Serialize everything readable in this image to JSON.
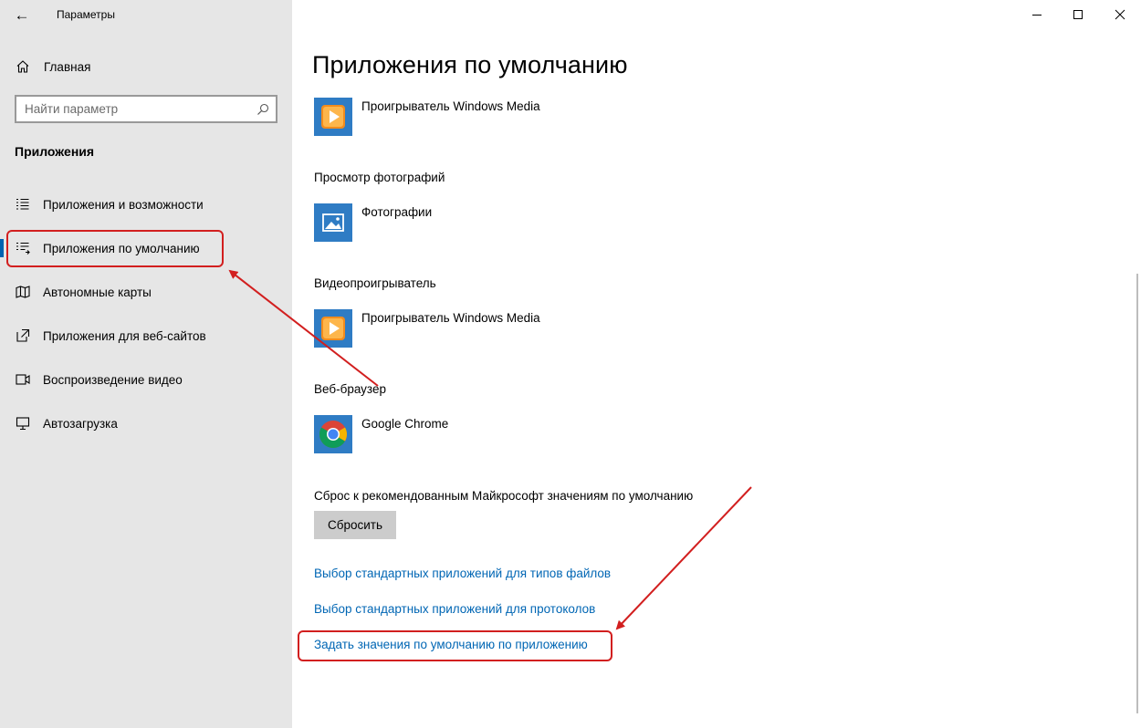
{
  "window": {
    "title": "Параметры",
    "back_glyph": "←",
    "minimize_glyph": "—",
    "maximize_glyph": "☐",
    "close_glyph": "✕"
  },
  "sidebar": {
    "home_label": "Главная",
    "search_placeholder": "Найти параметр",
    "section_heading": "Приложения",
    "items": [
      {
        "label": "Приложения и возможности",
        "icon": "list-icon"
      },
      {
        "label": "Приложения по умолчанию",
        "icon": "default-apps-icon",
        "selected": true
      },
      {
        "label": "Автономные карты",
        "icon": "map-icon"
      },
      {
        "label": "Приложения для веб-сайтов",
        "icon": "open-in-new-icon"
      },
      {
        "label": "Воспроизведение видео",
        "icon": "video-icon"
      },
      {
        "label": "Автозагрузка",
        "icon": "startup-icon"
      }
    ]
  },
  "main": {
    "title": "Приложения по умолчанию",
    "groups": [
      {
        "label": "",
        "app": "Проигрыватель Windows Media",
        "icon": "media-player-icon"
      },
      {
        "label": "Просмотр фотографий",
        "app": "Фотографии",
        "icon": "photos-icon"
      },
      {
        "label": "Видеопроигрыватель",
        "app": "Проигрыватель Windows Media",
        "icon": "media-player-icon"
      },
      {
        "label": "Веб-браузер",
        "app": "Google Chrome",
        "icon": "chrome-icon"
      }
    ],
    "reset_label": "Сброс к рекомендованным Майкрософт значениям по умолчанию",
    "reset_button": "Сбросить",
    "links": [
      "Выбор стандартных приложений для типов файлов",
      "Выбор стандартных приложений для протоколов",
      "Задать значения по умолчанию по приложению"
    ]
  },
  "colors": {
    "sidebar_bg": "#e6e6e6",
    "accent": "#0063b1",
    "link": "#0066b4",
    "annotation": "#d21f1f"
  }
}
